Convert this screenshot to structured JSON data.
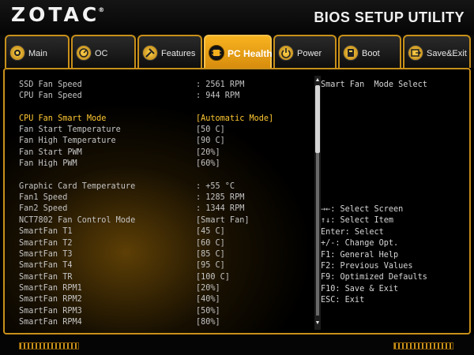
{
  "header": {
    "logo": "ZOTAC",
    "logo_reg": "®",
    "title": "BIOS SETUP UTILITY"
  },
  "tabs": [
    {
      "label": "Main",
      "icon": "main-icon"
    },
    {
      "label": "OC",
      "icon": "oc-icon"
    },
    {
      "label": "Features",
      "icon": "features-icon"
    },
    {
      "label": "PC Health",
      "icon": "chip-icon",
      "active": true
    },
    {
      "label": "Power",
      "icon": "power-icon"
    },
    {
      "label": "Boot",
      "icon": "boot-icon"
    },
    {
      "label": "Save&Exit",
      "icon": "save-exit-icon"
    }
  ],
  "settings": [
    {
      "label": "SSD Fan Speed",
      "value": ": 2561 RPM"
    },
    {
      "label": "CPU Fan Speed",
      "value": ": 944 RPM"
    },
    {
      "label": "CPU Fan Smart Mode",
      "value": "[Automatic Mode]"
    },
    {
      "label": "Fan Start Temperature",
      "value": "[50 C]"
    },
    {
      "label": "Fan High Temperature",
      "value": "[90 C]"
    },
    {
      "label": "Fan Start PWM",
      "value": "[20%]"
    },
    {
      "label": "Fan High PWM",
      "value": "[60%]"
    },
    {
      "label": "Graphic Card Temperature",
      "value": ": +55 °C"
    },
    {
      "label": "Fan1 Speed",
      "value": ": 1285 RPM"
    },
    {
      "label": "Fan2 Speed",
      "value": ": 1344 RPM"
    },
    {
      "label": "NCT7802 Fan Control Mode",
      "value": "[Smart Fan]"
    },
    {
      "label": "SmartFan T1",
      "value": "[45 C]"
    },
    {
      "label": "SmartFan T2",
      "value": "[60 C]"
    },
    {
      "label": "SmartFan T3",
      "value": "[85 C]"
    },
    {
      "label": "SmartFan T4",
      "value": "[95 C]"
    },
    {
      "label": "SmartFan TR",
      "value": "[100 C]"
    },
    {
      "label": "SmartFan RPM1",
      "value": "[20%]"
    },
    {
      "label": "SmartFan RPM2",
      "value": "[40%]"
    },
    {
      "label": "SmartFan RPM3",
      "value": "[50%]"
    },
    {
      "label": "SmartFan RPM4",
      "value": "[80%]"
    }
  ],
  "selected_setting": "CPU Fan Smart Mode",
  "help": {
    "description": "Smart Fan  Mode Select",
    "keys": [
      "→←: Select Screen",
      "↑↓: Select Item",
      "Enter: Select",
      "+/-: Change Opt.",
      "F1: General Help",
      "F2: Previous Values",
      "F9: Optimized Defaults",
      "F10: Save & Exit",
      "ESC: Exit"
    ]
  },
  "colors": {
    "accent": "#c8901a",
    "active_tab": "#f0a81c",
    "selected_text": "#ffc832",
    "text": "#c4c4c4"
  }
}
